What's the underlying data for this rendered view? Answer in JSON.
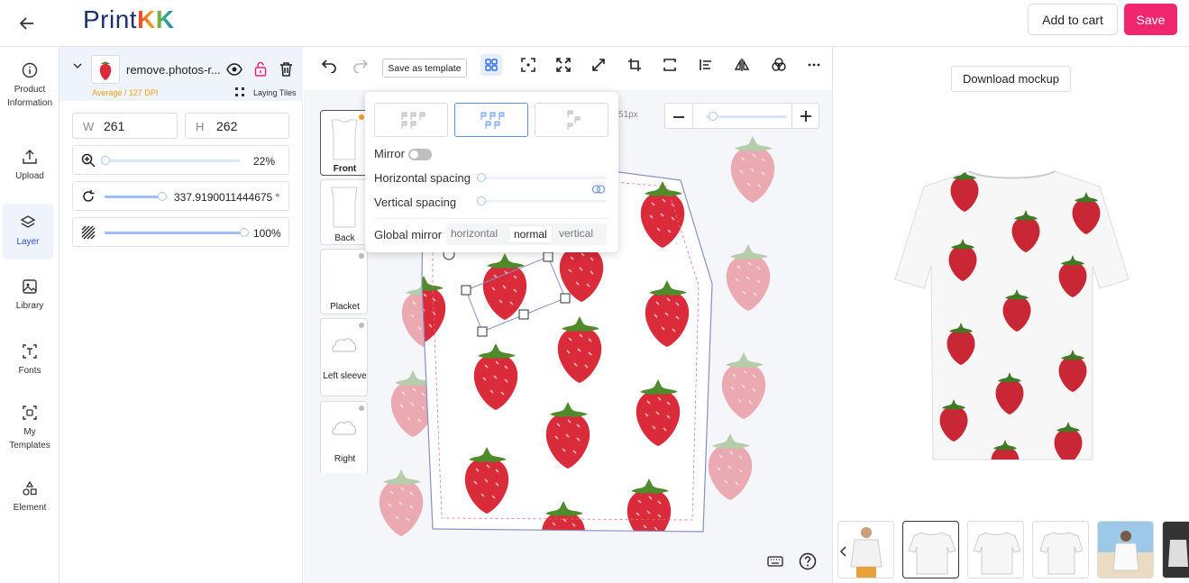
{
  "app": {
    "logo_part1": "Print",
    "logo_part2": "KK"
  },
  "header": {
    "add_to_cart": "Add to cart",
    "save": "Save"
  },
  "nav": [
    {
      "label": "Product Information",
      "icon": "info-icon"
    },
    {
      "label": "Upload",
      "icon": "upload-icon"
    },
    {
      "label": "Layer",
      "icon": "layers-icon"
    },
    {
      "label": "Library",
      "icon": "image-icon"
    },
    {
      "label": "Fonts",
      "icon": "text-icon"
    },
    {
      "label": "My Templates",
      "icon": "template-icon"
    },
    {
      "label": "Element",
      "icon": "shapes-icon"
    }
  ],
  "layer": {
    "name": "remove.photos-r...",
    "dpi": "Average / 127 DPI",
    "tiling": "Laying Tiles",
    "w_key": "W",
    "w": "261",
    "h_key": "H",
    "h": "262",
    "zoom": "22%",
    "rotation": "337.9190011444675 °",
    "opacity": "100%",
    "zoom_level": 0.0,
    "rotation_level": 0.94,
    "opacity_level": 1.0
  },
  "toolbar": {
    "save_template": "Save as template"
  },
  "popup": {
    "mirror": "Mirror",
    "horizontal_spacing": "Horizontal spacing",
    "vertical_spacing": "Vertical spacing",
    "global_mirror": "Global mirror",
    "global_options": [
      "horizontal",
      "normal",
      "vertical"
    ],
    "selected_option": "normal"
  },
  "sides": [
    {
      "label": "Front"
    },
    {
      "label": "Back"
    },
    {
      "label": "Placket"
    },
    {
      "label": "Left sleeve"
    },
    {
      "label": "Right"
    }
  ],
  "canvas": {
    "px_fragment": "51px"
  },
  "mockup": {
    "download": "Download mockup"
  },
  "colors": {
    "accent": "#f0266f",
    "brand": "#1d2e6e",
    "active_nav": "#eef3fc",
    "strawberry": "#d92b3a",
    "leaf": "#4f8a2b"
  }
}
